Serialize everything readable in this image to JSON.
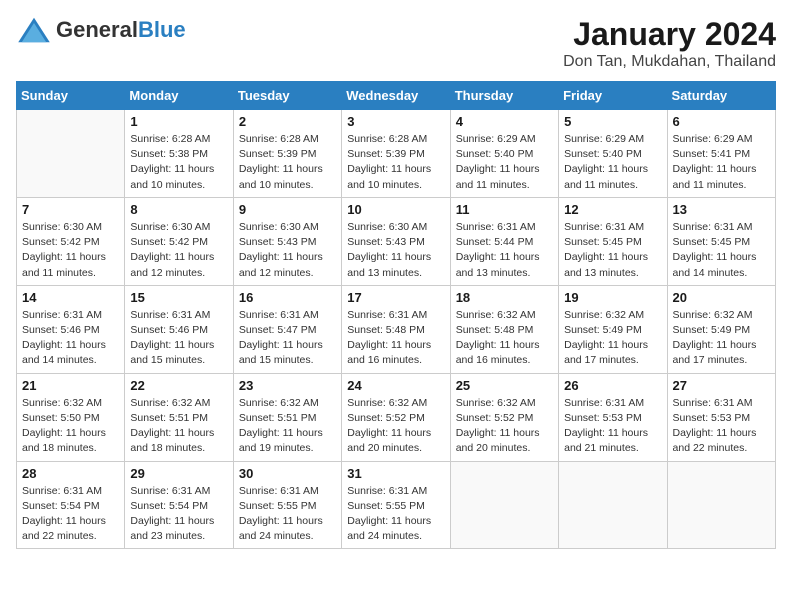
{
  "header": {
    "logo_general": "General",
    "logo_blue": "Blue",
    "title": "January 2024",
    "subtitle": "Don Tan, Mukdahan, Thailand"
  },
  "days_of_week": [
    "Sunday",
    "Monday",
    "Tuesday",
    "Wednesday",
    "Thursday",
    "Friday",
    "Saturday"
  ],
  "weeks": [
    [
      {
        "day": "",
        "info": ""
      },
      {
        "day": "1",
        "info": "Sunrise: 6:28 AM\nSunset: 5:38 PM\nDaylight: 11 hours\nand 10 minutes."
      },
      {
        "day": "2",
        "info": "Sunrise: 6:28 AM\nSunset: 5:39 PM\nDaylight: 11 hours\nand 10 minutes."
      },
      {
        "day": "3",
        "info": "Sunrise: 6:28 AM\nSunset: 5:39 PM\nDaylight: 11 hours\nand 10 minutes."
      },
      {
        "day": "4",
        "info": "Sunrise: 6:29 AM\nSunset: 5:40 PM\nDaylight: 11 hours\nand 11 minutes."
      },
      {
        "day": "5",
        "info": "Sunrise: 6:29 AM\nSunset: 5:40 PM\nDaylight: 11 hours\nand 11 minutes."
      },
      {
        "day": "6",
        "info": "Sunrise: 6:29 AM\nSunset: 5:41 PM\nDaylight: 11 hours\nand 11 minutes."
      }
    ],
    [
      {
        "day": "7",
        "info": "Sunrise: 6:30 AM\nSunset: 5:42 PM\nDaylight: 11 hours\nand 11 minutes."
      },
      {
        "day": "8",
        "info": "Sunrise: 6:30 AM\nSunset: 5:42 PM\nDaylight: 11 hours\nand 12 minutes."
      },
      {
        "day": "9",
        "info": "Sunrise: 6:30 AM\nSunset: 5:43 PM\nDaylight: 11 hours\nand 12 minutes."
      },
      {
        "day": "10",
        "info": "Sunrise: 6:30 AM\nSunset: 5:43 PM\nDaylight: 11 hours\nand 13 minutes."
      },
      {
        "day": "11",
        "info": "Sunrise: 6:31 AM\nSunset: 5:44 PM\nDaylight: 11 hours\nand 13 minutes."
      },
      {
        "day": "12",
        "info": "Sunrise: 6:31 AM\nSunset: 5:45 PM\nDaylight: 11 hours\nand 13 minutes."
      },
      {
        "day": "13",
        "info": "Sunrise: 6:31 AM\nSunset: 5:45 PM\nDaylight: 11 hours\nand 14 minutes."
      }
    ],
    [
      {
        "day": "14",
        "info": "Sunrise: 6:31 AM\nSunset: 5:46 PM\nDaylight: 11 hours\nand 14 minutes."
      },
      {
        "day": "15",
        "info": "Sunrise: 6:31 AM\nSunset: 5:46 PM\nDaylight: 11 hours\nand 15 minutes."
      },
      {
        "day": "16",
        "info": "Sunrise: 6:31 AM\nSunset: 5:47 PM\nDaylight: 11 hours\nand 15 minutes."
      },
      {
        "day": "17",
        "info": "Sunrise: 6:31 AM\nSunset: 5:48 PM\nDaylight: 11 hours\nand 16 minutes."
      },
      {
        "day": "18",
        "info": "Sunrise: 6:32 AM\nSunset: 5:48 PM\nDaylight: 11 hours\nand 16 minutes."
      },
      {
        "day": "19",
        "info": "Sunrise: 6:32 AM\nSunset: 5:49 PM\nDaylight: 11 hours\nand 17 minutes."
      },
      {
        "day": "20",
        "info": "Sunrise: 6:32 AM\nSunset: 5:49 PM\nDaylight: 11 hours\nand 17 minutes."
      }
    ],
    [
      {
        "day": "21",
        "info": "Sunrise: 6:32 AM\nSunset: 5:50 PM\nDaylight: 11 hours\nand 18 minutes."
      },
      {
        "day": "22",
        "info": "Sunrise: 6:32 AM\nSunset: 5:51 PM\nDaylight: 11 hours\nand 18 minutes."
      },
      {
        "day": "23",
        "info": "Sunrise: 6:32 AM\nSunset: 5:51 PM\nDaylight: 11 hours\nand 19 minutes."
      },
      {
        "day": "24",
        "info": "Sunrise: 6:32 AM\nSunset: 5:52 PM\nDaylight: 11 hours\nand 20 minutes."
      },
      {
        "day": "25",
        "info": "Sunrise: 6:32 AM\nSunset: 5:52 PM\nDaylight: 11 hours\nand 20 minutes."
      },
      {
        "day": "26",
        "info": "Sunrise: 6:31 AM\nSunset: 5:53 PM\nDaylight: 11 hours\nand 21 minutes."
      },
      {
        "day": "27",
        "info": "Sunrise: 6:31 AM\nSunset: 5:53 PM\nDaylight: 11 hours\nand 22 minutes."
      }
    ],
    [
      {
        "day": "28",
        "info": "Sunrise: 6:31 AM\nSunset: 5:54 PM\nDaylight: 11 hours\nand 22 minutes."
      },
      {
        "day": "29",
        "info": "Sunrise: 6:31 AM\nSunset: 5:54 PM\nDaylight: 11 hours\nand 23 minutes."
      },
      {
        "day": "30",
        "info": "Sunrise: 6:31 AM\nSunset: 5:55 PM\nDaylight: 11 hours\nand 24 minutes."
      },
      {
        "day": "31",
        "info": "Sunrise: 6:31 AM\nSunset: 5:55 PM\nDaylight: 11 hours\nand 24 minutes."
      },
      {
        "day": "",
        "info": ""
      },
      {
        "day": "",
        "info": ""
      },
      {
        "day": "",
        "info": ""
      }
    ]
  ]
}
